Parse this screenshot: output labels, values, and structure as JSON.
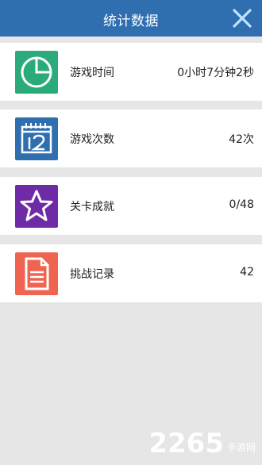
{
  "header": {
    "title": "统计数据",
    "close_icon": "close-icon",
    "bg_color": "#2f6fb0"
  },
  "rows": [
    {
      "label": "游戏时间",
      "value": "0小时7分钟2秒",
      "icon": "clock-icon",
      "icon_color": "#2bab7a"
    },
    {
      "label": "游戏次数",
      "value": "42次",
      "icon": "calendar-icon",
      "icon_color": "#2f6fb0"
    },
    {
      "label": "关卡成就",
      "value": "0/48",
      "icon": "star-icon",
      "icon_color": "#6f2aa6"
    },
    {
      "label": "挑战记录",
      "value": "42",
      "icon": "document-icon",
      "icon_color": "#ee6450"
    }
  ],
  "watermark": {
    "number": "2265",
    "site": "手游网"
  }
}
